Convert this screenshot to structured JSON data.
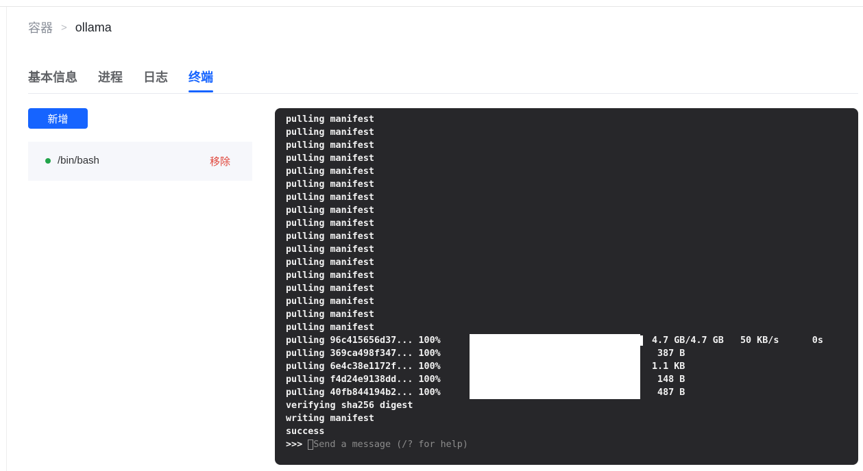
{
  "breadcrumb": {
    "root": "容器",
    "separator": ">",
    "current": "ollama"
  },
  "tabs": [
    {
      "label": "基本信息",
      "active": false
    },
    {
      "label": "进程",
      "active": false
    },
    {
      "label": "日志",
      "active": false
    },
    {
      "label": "终端",
      "active": true
    }
  ],
  "actions": {
    "add_label": "新增"
  },
  "sessions": [
    {
      "command": "/bin/bash",
      "status": "running",
      "remove_label": "移除"
    }
  ],
  "terminal": {
    "repeat_lines": [
      "pulling manifest",
      "pulling manifest",
      "pulling manifest",
      "pulling manifest",
      "pulling manifest",
      "pulling manifest",
      "pulling manifest",
      "pulling manifest",
      "pulling manifest",
      "pulling manifest",
      "pulling manifest",
      "pulling manifest",
      "pulling manifest",
      "pulling manifest",
      "pulling manifest",
      "pulling manifest",
      "pulling manifest"
    ],
    "pulls": [
      {
        "label": "pulling 96c415656d37... 100%",
        "stat": "4.7 GB/4.7 GB   50 KB/s      0s",
        "progress": 1.0
      },
      {
        "label": "pulling 369ca498f347... 100%",
        "stat": " 387 B",
        "progress": 1.0
      },
      {
        "label": "pulling 6e4c38e1172f... 100%",
        "stat": "1.1 KB",
        "progress": 1.0
      },
      {
        "label": "pulling f4d24e9138dd... 100%",
        "stat": " 148 B",
        "progress": 1.0
      },
      {
        "label": "pulling 40fb844194b2... 100%",
        "stat": " 487 B",
        "progress": 1.0
      }
    ],
    "tail_lines": [
      "verifying sha256 digest",
      "writing manifest",
      "success"
    ],
    "prompt": {
      "mark": ">>>",
      "placeholder": "Send a message (/? for help)"
    }
  },
  "colors": {
    "accent": "#1664ff",
    "status_running": "#22a44a",
    "danger": "#e0453a",
    "terminal_bg": "#27272a"
  }
}
